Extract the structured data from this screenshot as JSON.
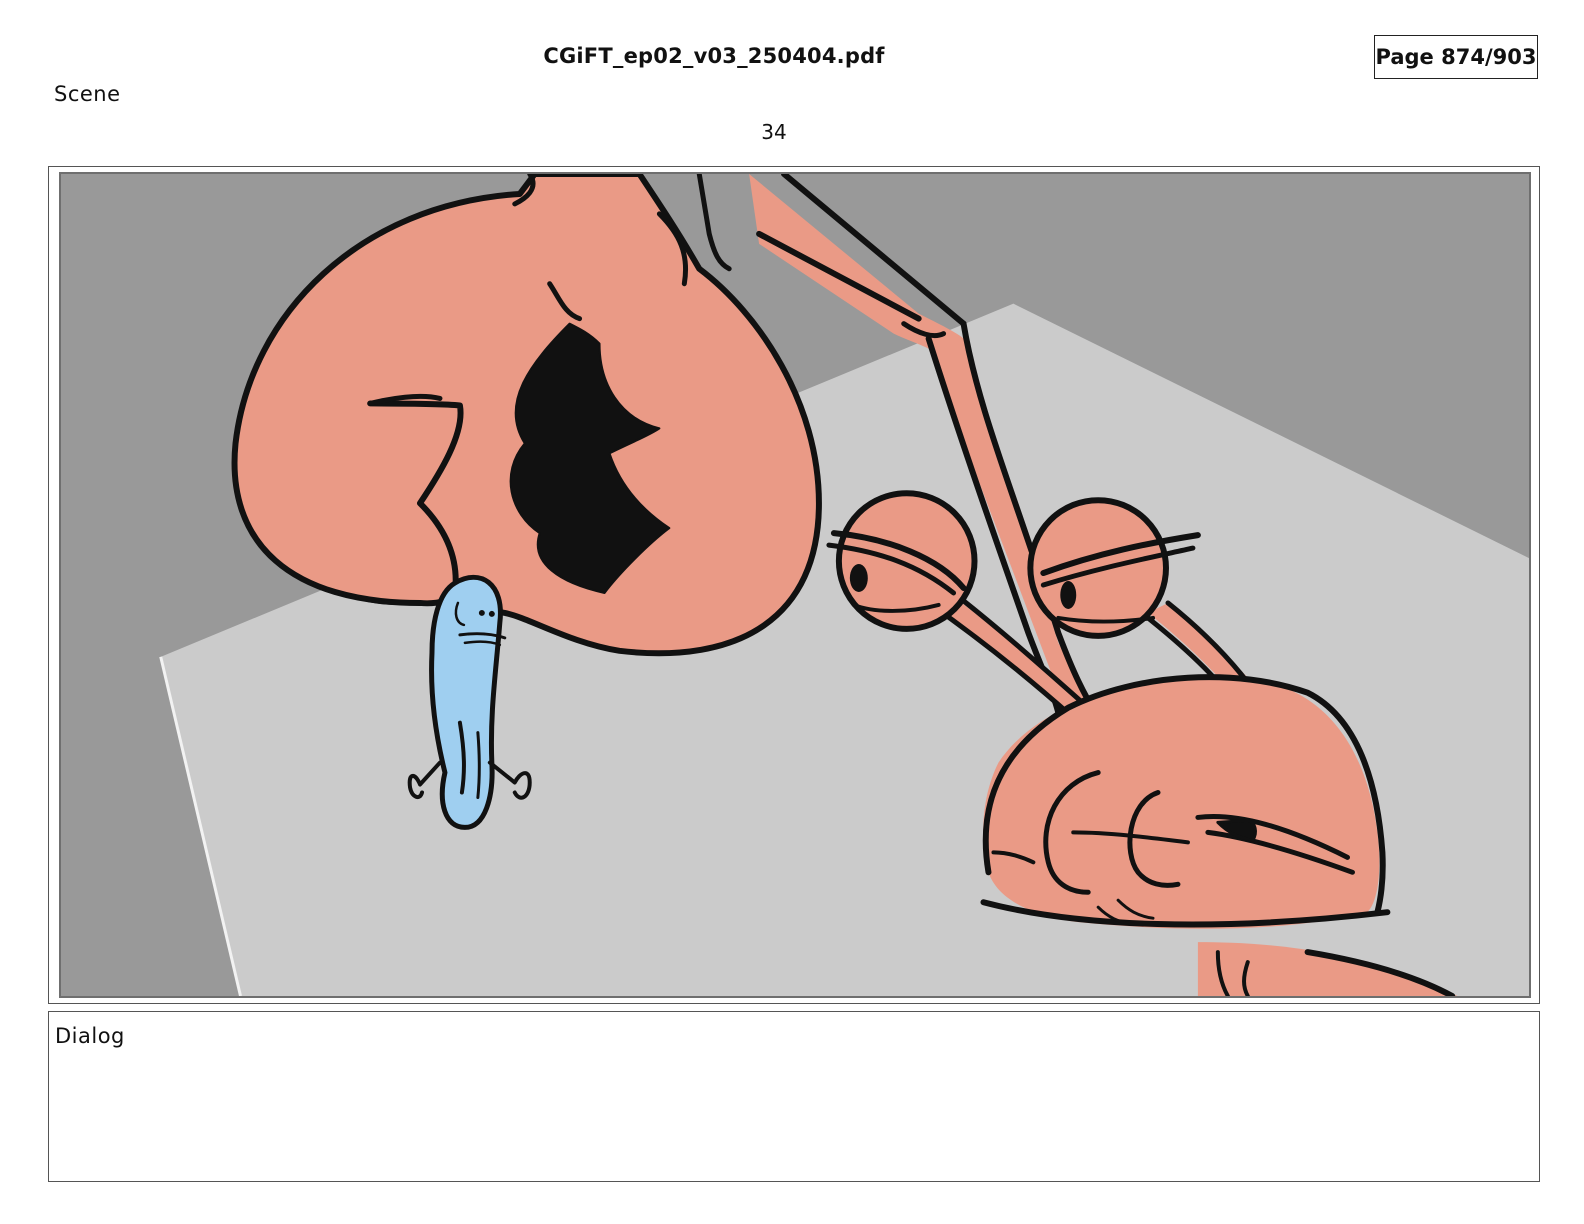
{
  "document": {
    "file_name": "CGiFT_ep02_v03_250404.pdf",
    "page_indicator": "Page 874/903"
  },
  "scene": {
    "label": "Scene",
    "number": "34"
  },
  "panel": {
    "colors": {
      "wall": "#999999",
      "floor": "#cbcbcb",
      "crab": "#ea9a86",
      "fish": "#9fcff0",
      "ink": "#111111"
    }
  },
  "dialog": {
    "label": "Dialog"
  }
}
